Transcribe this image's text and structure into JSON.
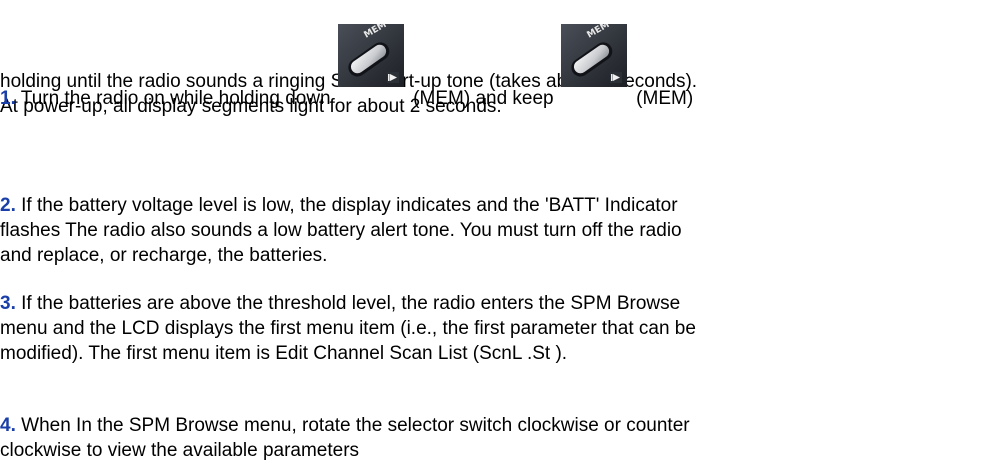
{
  "steps": [
    {
      "number": "1.",
      "line1_a": " Turn the radio on while holding down ",
      "line1_b": " (MEM) and keep ",
      "line1_c": " (MEM)",
      "line2": "holding until the radio sounds a ringing SPM start-up tone (takes about 3 seconds).",
      "line3": "At power-up, all display segments light for about 2 seconds."
    },
    {
      "number": "2.",
      "line1": " If the battery voltage level is low, the display indicates and the 'BATT' Indicator",
      "line2": "flashes The radio also sounds a low battery alert tone. You must turn off the radio",
      "line3": "and replace, or recharge, the batteries."
    },
    {
      "number": "3.",
      "line1": " If the batteries are above the threshold level, the radio enters the SPM Browse",
      "line2": "menu and the LCD displays the first menu item (i.e., the first parameter that can be",
      "line3": "modified). The first menu item is Edit Channel Scan List (ScnL .St )."
    },
    {
      "number": "4.",
      "line1": " When In the SPM Browse menu, rotate the selector switch clockwise or counter",
      "line2": "clockwise to view the available parameters"
    }
  ],
  "icons": {
    "mem_button": {
      "name": "mem-button-icon",
      "label": "MEM"
    }
  },
  "colors": {
    "step_number": "#1a3fa8",
    "text": "#000000",
    "background": "#ffffff"
  }
}
